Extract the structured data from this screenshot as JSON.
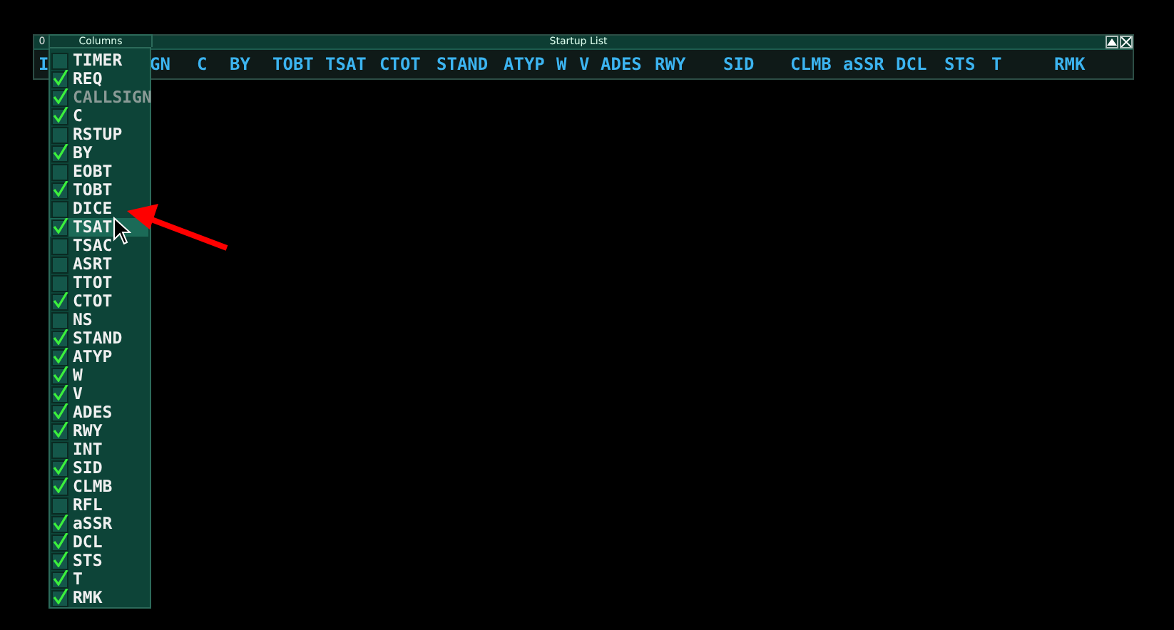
{
  "window": {
    "title": "Startup List",
    "counter": "0"
  },
  "header_columns": [
    "I",
    "GN",
    "C",
    "BY",
    "TOBT",
    "TSAT",
    "CTOT",
    "STAND",
    "ATYP",
    "W",
    "V",
    "ADES",
    "RWY",
    "SID",
    "CLMB",
    "aSSR",
    "DCL",
    "STS",
    "T",
    "RMK"
  ],
  "columns_menu": {
    "title": "Columns",
    "items": [
      {
        "label": "TIMER",
        "checked": false,
        "disabled": false,
        "hovered": false
      },
      {
        "label": "REQ",
        "checked": true,
        "disabled": false,
        "hovered": false
      },
      {
        "label": "CALLSIGN",
        "checked": true,
        "disabled": true,
        "hovered": false
      },
      {
        "label": "C",
        "checked": true,
        "disabled": false,
        "hovered": false
      },
      {
        "label": "RSTUP",
        "checked": false,
        "disabled": false,
        "hovered": false
      },
      {
        "label": "BY",
        "checked": true,
        "disabled": false,
        "hovered": false
      },
      {
        "label": "EOBT",
        "checked": false,
        "disabled": false,
        "hovered": false
      },
      {
        "label": "TOBT",
        "checked": true,
        "disabled": false,
        "hovered": false
      },
      {
        "label": "DICE",
        "checked": false,
        "disabled": false,
        "hovered": false
      },
      {
        "label": "TSAT",
        "checked": true,
        "disabled": false,
        "hovered": true
      },
      {
        "label": "TSAC",
        "checked": false,
        "disabled": false,
        "hovered": false
      },
      {
        "label": "ASRT",
        "checked": false,
        "disabled": false,
        "hovered": false
      },
      {
        "label": "TTOT",
        "checked": false,
        "disabled": false,
        "hovered": false
      },
      {
        "label": "CTOT",
        "checked": true,
        "disabled": false,
        "hovered": false
      },
      {
        "label": "NS",
        "checked": false,
        "disabled": false,
        "hovered": false
      },
      {
        "label": "STAND",
        "checked": true,
        "disabled": false,
        "hovered": false
      },
      {
        "label": "ATYP",
        "checked": true,
        "disabled": false,
        "hovered": false
      },
      {
        "label": "W",
        "checked": true,
        "disabled": false,
        "hovered": false
      },
      {
        "label": "V",
        "checked": true,
        "disabled": false,
        "hovered": false
      },
      {
        "label": "ADES",
        "checked": true,
        "disabled": false,
        "hovered": false
      },
      {
        "label": "RWY",
        "checked": true,
        "disabled": false,
        "hovered": false
      },
      {
        "label": "INT",
        "checked": false,
        "disabled": false,
        "hovered": false
      },
      {
        "label": "SID",
        "checked": true,
        "disabled": false,
        "hovered": false
      },
      {
        "label": "CLMB",
        "checked": true,
        "disabled": false,
        "hovered": false
      },
      {
        "label": "RFL",
        "checked": false,
        "disabled": false,
        "hovered": false
      },
      {
        "label": "aSSR",
        "checked": true,
        "disabled": false,
        "hovered": false
      },
      {
        "label": "DCL",
        "checked": true,
        "disabled": false,
        "hovered": false
      },
      {
        "label": "STS",
        "checked": true,
        "disabled": false,
        "hovered": false
      },
      {
        "label": "T",
        "checked": true,
        "disabled": false,
        "hovered": false
      },
      {
        "label": "RMK",
        "checked": true,
        "disabled": false,
        "hovered": false
      }
    ]
  }
}
